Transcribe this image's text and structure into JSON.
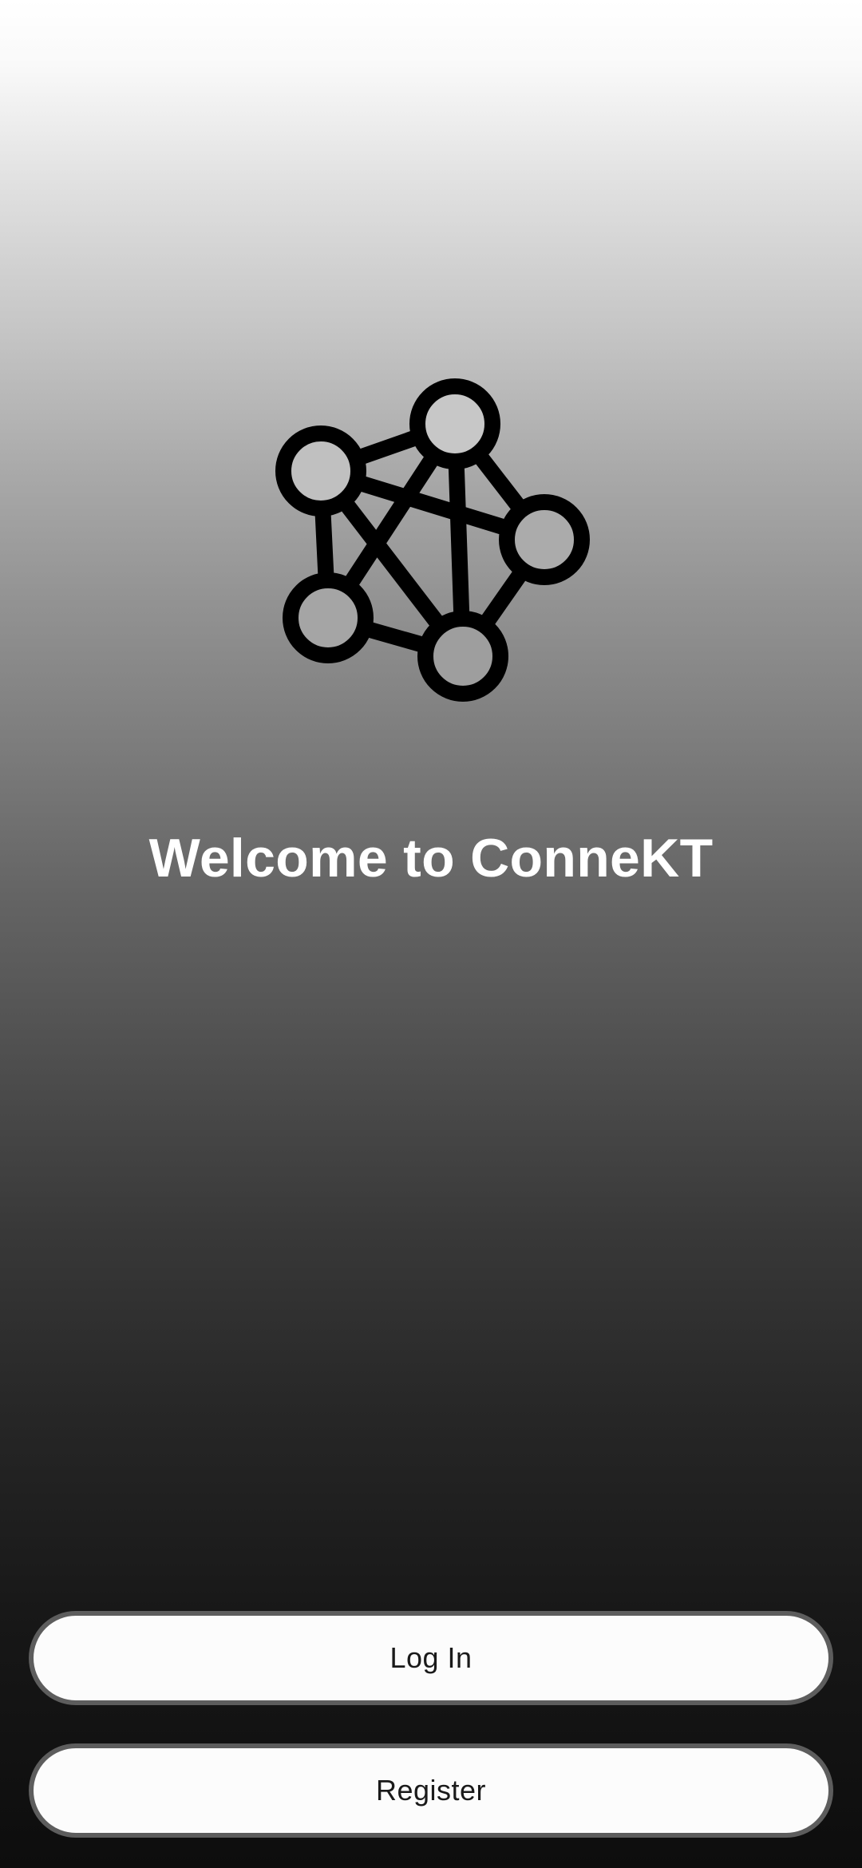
{
  "app": {
    "logo_icon": "network-graph-icon",
    "title": "Welcome to ConneKT"
  },
  "actions": {
    "login_label": "Log In",
    "register_label": "Register"
  },
  "colors": {
    "title": "#ffffff",
    "button_bg": "#fcfcfc",
    "button_border": "#5d5d5d",
    "button_text": "#1a1a1a",
    "logo": "#000000"
  }
}
